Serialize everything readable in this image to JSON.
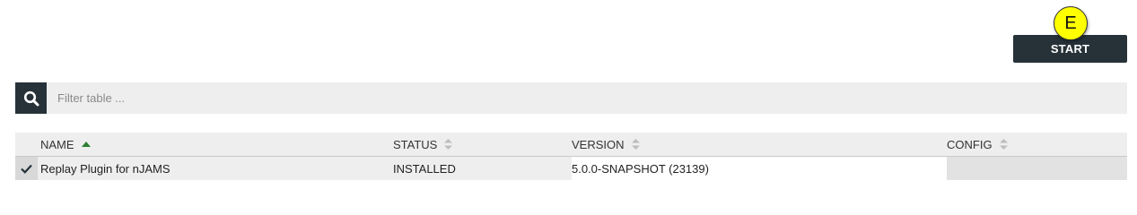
{
  "marker": {
    "label": "E",
    "color": "#ffff00"
  },
  "toolbar": {
    "start_label": "START"
  },
  "filter": {
    "placeholder": "Filter table ...",
    "value": ""
  },
  "table": {
    "columns": {
      "name": "NAME",
      "status": "STATUS",
      "version": "VERSION",
      "config": "CONFIG"
    },
    "sorted_column": "name",
    "sort_direction": "ascending",
    "rows": [
      {
        "selected": true,
        "name": "Replay Plugin for nJAMS",
        "status": "INSTALLED",
        "version": "5.0.0-SNAPSHOT (23139)",
        "config": ""
      }
    ]
  },
  "colors": {
    "accent_dark": "#263238",
    "sort_active": "#2e7d32",
    "sort_inactive": "#bdbdbd"
  }
}
